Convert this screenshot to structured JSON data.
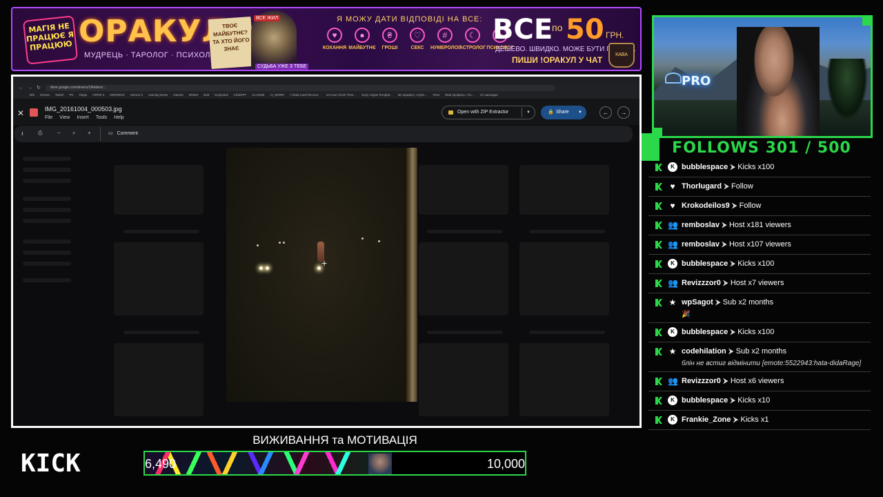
{
  "banner": {
    "tag_left": "МАГІЯ НЕ ПРАЦЮЄ Я ПРАЦЮЮ",
    "brand": "ОРАКУЛ",
    "brand_sub": "МУДРЕЦЬ · ТАРОЛОГ · ПСИХОЛОГ",
    "note": "ТВОЄ МАЙБУТНЄ? ТА ХТО ЙОГО ЗНАЄ",
    "wizard_tag_top": "ВСЕ ЖИЛ",
    "wizard_tag_bottom": "СУДЬБА УЖЕ З ТЕБЕ",
    "slogan": "Я МОЖУ ДАТИ ВІДПОВІДІ НА ВСЕ:",
    "categories": [
      {
        "icon": "heart-icon",
        "glyph": "♥",
        "label": "КОХАННЯ"
      },
      {
        "icon": "crystal-ball-icon",
        "glyph": "●",
        "label": "МАЙБУТНЄ"
      },
      {
        "icon": "money-icon",
        "glyph": "₴",
        "label": "ГРОШІ"
      },
      {
        "icon": "sex-icon",
        "glyph": "♡",
        "label": "СЕКС"
      },
      {
        "icon": "numerology-icon",
        "glyph": "#",
        "label": "НУМЕРОЛОГ"
      },
      {
        "icon": "moon-icon",
        "glyph": "☾",
        "label": "АСТРОЛОГ"
      },
      {
        "icon": "brain-icon",
        "glyph": "✦",
        "label": "ПСИХОЛОГ"
      }
    ],
    "price_main": "ВСЕ",
    "price_po": "по",
    "price_num": "50",
    "price_cur": "ГРН.",
    "price_sub": "ДЕШЕВО. ШВИДКО. МОЖЕ БУТИ ПРАВДА.",
    "price_cta": "ПИШИ !ОРАКУЛ У ЧАТ",
    "mug_label": "КАВА"
  },
  "browser": {
    "url": "drive.google.com/drive/u/1/folders/...",
    "bookmarks": [
      "Brb",
      "Kinesa",
      "Twitch",
      "PC",
      "Радіо",
      "ГЕРОЇ 3",
      "HEROES3",
      "Heroes 3",
      "Gaming News",
      "Games",
      "MODS",
      "Bob",
      "Keyboard",
      "ChatGPT",
      "CLAUDE",
      "AI_WORK",
      "7 Data Card Recove...",
      "24 Hour Clock Time...",
      "Sony Vegas Templat...",
      "2D шрифти, стрічк...",
      "Ytms",
      "Мой профиль • GL...",
      "Усі закладки"
    ]
  },
  "viewer": {
    "file_name": "IMG_20161004_000503.jpg",
    "menu": [
      "File",
      "View",
      "Insert",
      "Tools",
      "Help"
    ],
    "open_with": "Open with ZIP Extractor",
    "share": "Share",
    "comment": "Comment"
  },
  "webcam": {
    "neon_sign": "PRO"
  },
  "follows": "FOLLOWS 301 / 500",
  "events": [
    {
      "type": "kicks",
      "icon": "K",
      "user": "bubblespace",
      "action": "Kicks x100"
    },
    {
      "type": "follow",
      "icon": "♥",
      "user": "Thorlugard",
      "action": "Follow"
    },
    {
      "type": "follow",
      "icon": "♥",
      "user": "Krokodeilos9",
      "action": "Follow"
    },
    {
      "type": "host",
      "icon": "👥",
      "user": "remboslav",
      "action": "Host x181 viewers"
    },
    {
      "type": "host",
      "icon": "👥",
      "user": "remboslav",
      "action": "Host x107 viewers"
    },
    {
      "type": "kicks",
      "icon": "K",
      "user": "bubblespace",
      "action": "Kicks x100"
    },
    {
      "type": "host",
      "icon": "👥",
      "user": "Revizzzor0",
      "action": "Host x7 viewers"
    },
    {
      "type": "sub",
      "icon": "★",
      "user": "wpSagot",
      "action": "Sub x2 months",
      "emote": "🎉"
    },
    {
      "type": "kicks",
      "icon": "K",
      "user": "bubblespace",
      "action": "Kicks x100"
    },
    {
      "type": "sub",
      "icon": "★",
      "user": "codehilation",
      "action": "Sub x2 months",
      "message": "блін не встиг відмінити [emote:5522943:hata-didaRage]"
    },
    {
      "type": "host",
      "icon": "👥",
      "user": "Revizzzor0",
      "action": "Host x6 viewers"
    },
    {
      "type": "kicks",
      "icon": "K",
      "user": "bubblespace",
      "action": "Kicks x10"
    },
    {
      "type": "kicks",
      "icon": "K",
      "user": "Frankie_Zone",
      "action": "Kicks x1"
    }
  ],
  "bottom": {
    "kick_logo": "KICK",
    "goal_title": "ВИЖИВАННЯ та МОТИВАЦІЯ",
    "goal_current": "6,490",
    "goal_max": "10,000",
    "goal_progress": 0.649
  },
  "colors": {
    "accent": "#2bd84a",
    "banner_border": "#b14cff",
    "share_button": "#1d4f8a"
  }
}
